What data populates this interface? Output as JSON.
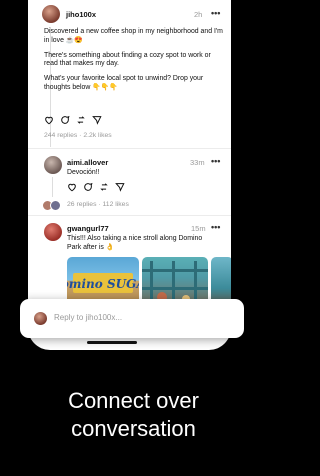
{
  "posts": [
    {
      "handle": "jiho100x",
      "time": "2h",
      "more": "•••",
      "paragraphs": [
        "Discovered a new coffee shop in my neighborhood and I'm in love ☕️😍",
        "There's something about finding a cozy spot to work or read that makes my day.",
        "What's your favorite local spot to unwind? Drop your thoughts below 👇👇👇"
      ],
      "replies": "244 replies",
      "likes": "2.2k likes"
    },
    {
      "handle": "aimi.allover",
      "time": "33m",
      "more": "•••",
      "text": "Devoción!!",
      "replies": "26 replies",
      "likes": "112 likes"
    },
    {
      "handle": "gwangurl77",
      "time": "15m",
      "more": "•••",
      "text": "This!!! Also taking a nice stroll along Domino Park after is 👌",
      "sign_text": "Domino SUGAR"
    }
  ],
  "separator": "·",
  "reply_bar": {
    "placeholder": "Reply to jiho100x..."
  },
  "caption": {
    "line1": "Connect over",
    "line2": "conversation"
  },
  "icons": [
    "heart-icon",
    "comment-icon",
    "repost-icon",
    "share-icon"
  ]
}
